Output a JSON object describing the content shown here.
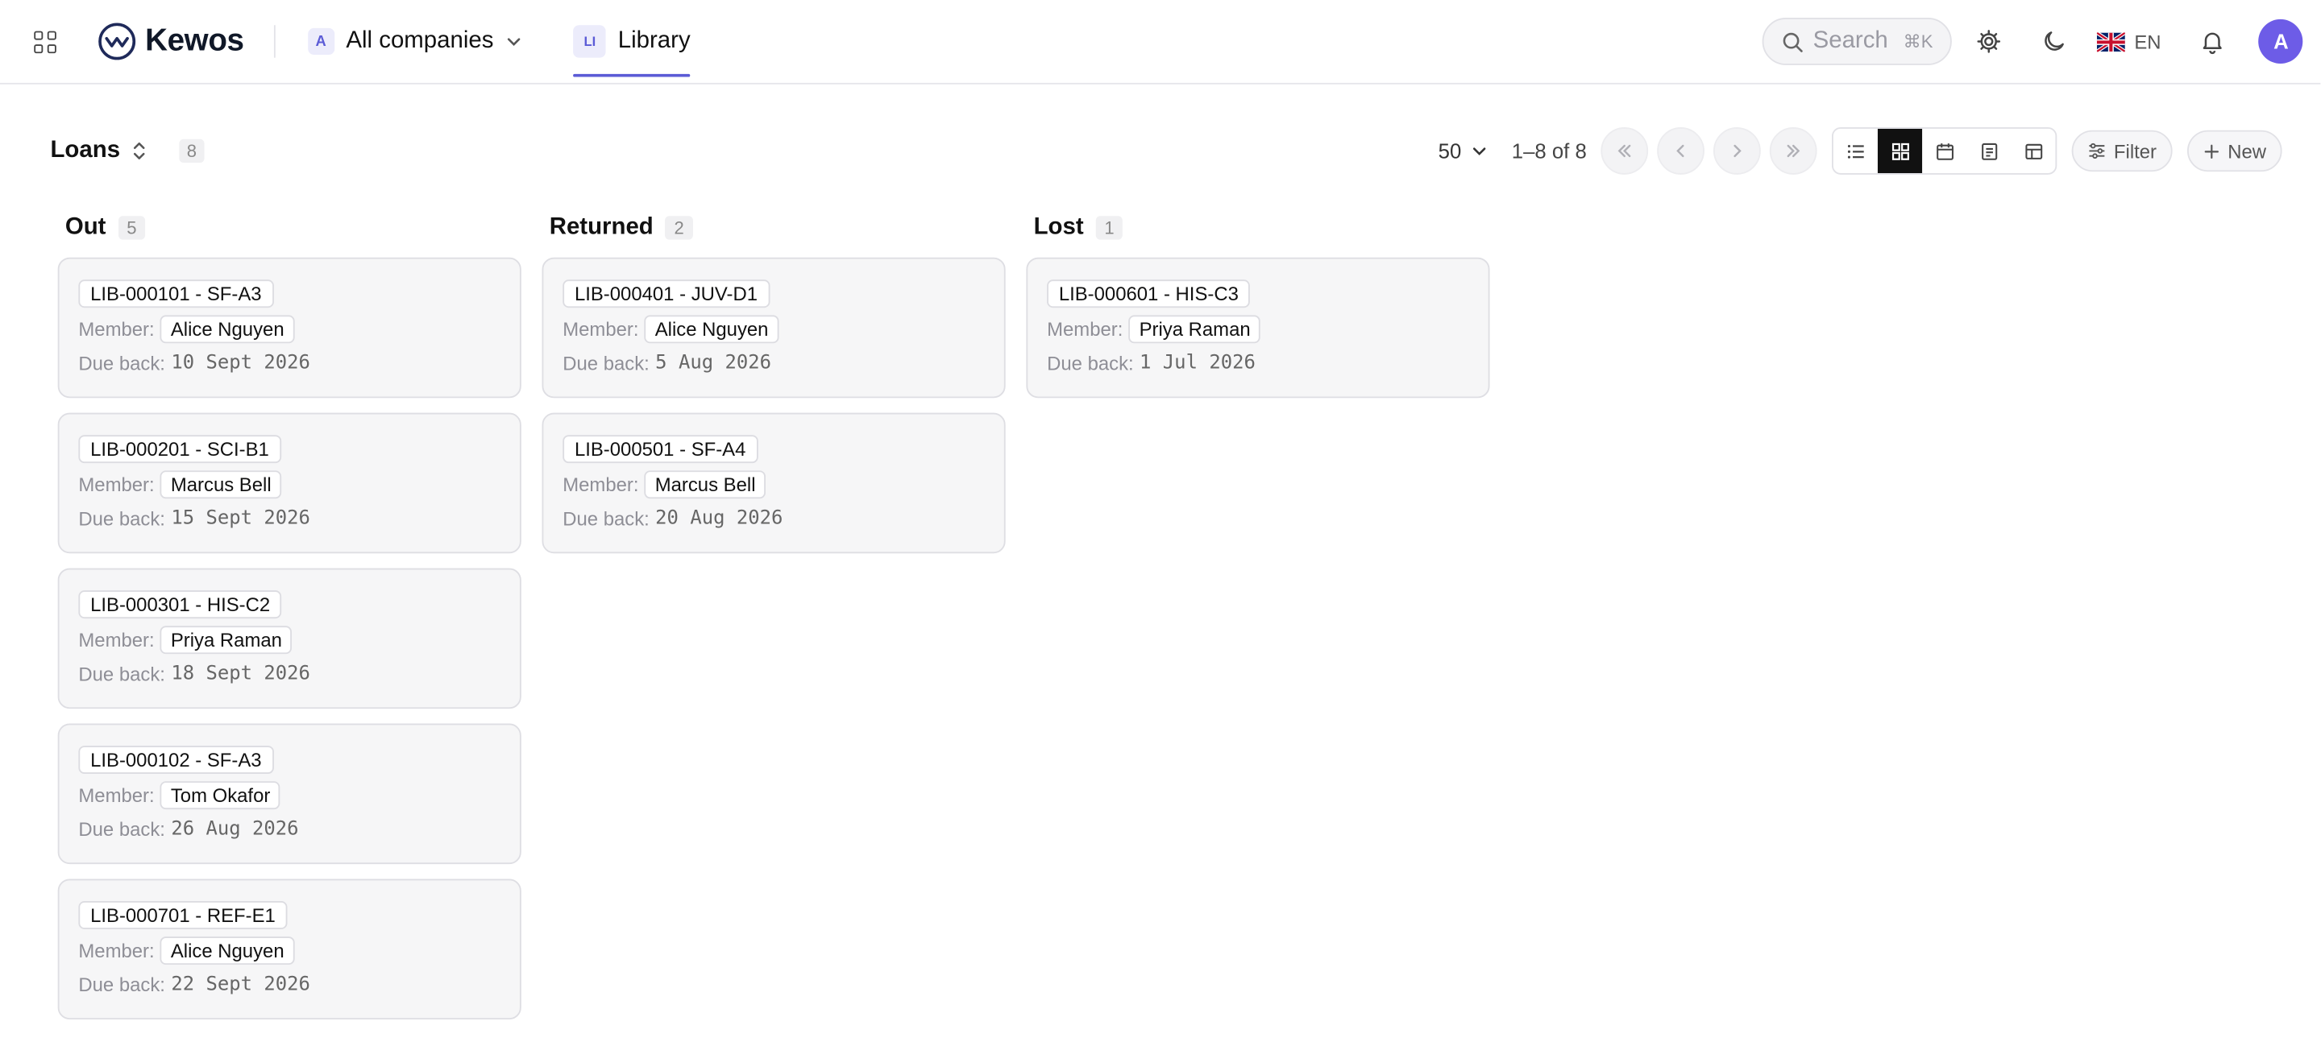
{
  "app": {
    "name": "Kewos"
  },
  "topbar": {
    "company": {
      "badge": "A",
      "label": "All companies"
    },
    "tab": {
      "badge": "LI",
      "label": "Library"
    },
    "search": {
      "placeholder": "Search",
      "shortcut": "⌘K"
    },
    "language": "EN",
    "avatar": "A",
    "icons": [
      "apps-grid-icon",
      "settings-gear-icon",
      "moon-theme-icon",
      "uk-flag-icon",
      "bell-icon"
    ]
  },
  "toolbar": {
    "collection": "Loans",
    "count": "8",
    "per_page": "50",
    "range": "1–8 of 8",
    "filter_label": "Filter",
    "new_label": "New",
    "active_view": "board"
  },
  "board": {
    "member_label": "Member:",
    "due_label": "Due back:",
    "columns": [
      {
        "title": "Out",
        "count": "5",
        "cards": [
          {
            "id": "LIB-000101 - SF-A3",
            "member": "Alice Nguyen",
            "due": "10 Sept 2026"
          },
          {
            "id": "LIB-000201 - SCI-B1",
            "member": "Marcus Bell",
            "due": "15 Sept 2026"
          },
          {
            "id": "LIB-000301 - HIS-C2",
            "member": "Priya Raman",
            "due": "18 Sept 2026"
          },
          {
            "id": "LIB-000102 - SF-A3",
            "member": "Tom Okafor",
            "due": "26 Aug 2026"
          },
          {
            "id": "LIB-000701 - REF-E1",
            "member": "Alice Nguyen",
            "due": "22 Sept 2026"
          }
        ]
      },
      {
        "title": "Returned",
        "count": "2",
        "cards": [
          {
            "id": "LIB-000401 - JUV-D1",
            "member": "Alice Nguyen",
            "due": "5 Aug 2026"
          },
          {
            "id": "LIB-000501 - SF-A4",
            "member": "Marcus Bell",
            "due": "20 Aug 2026"
          }
        ]
      },
      {
        "title": "Lost",
        "count": "1",
        "cards": [
          {
            "id": "LIB-000601 - HIS-C3",
            "member": "Priya Raman",
            "due": "1 Jul 2026"
          }
        ]
      }
    ]
  },
  "colors": {
    "accent": "#5b5bd6",
    "avatar": "#6d5ce7",
    "card_bg": "#f6f6f7"
  }
}
